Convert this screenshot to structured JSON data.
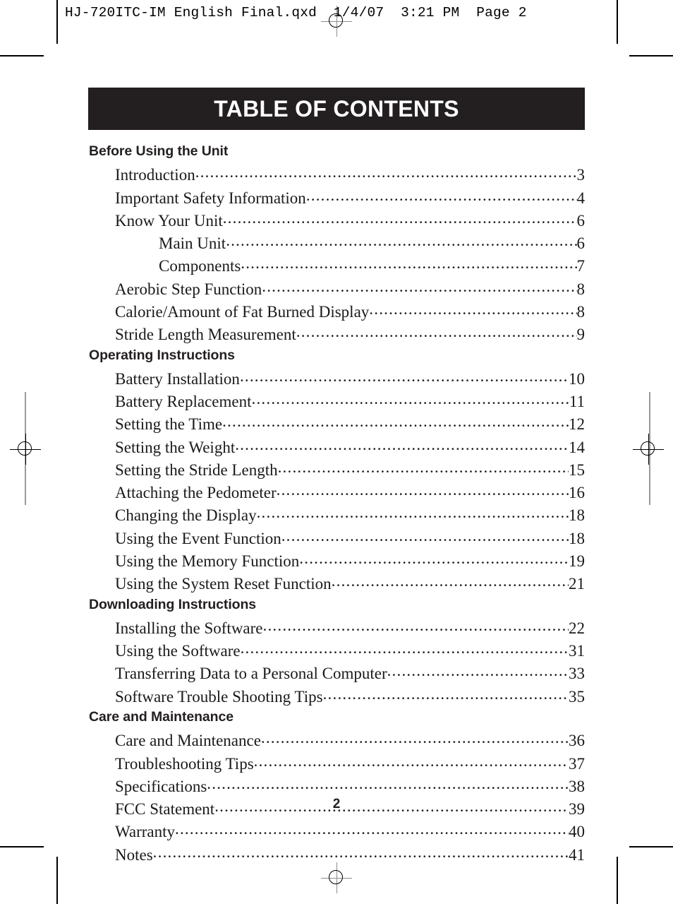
{
  "header_slug": "HJ-720ITC-IM English Final.qxd  1/4/07  3:21 PM  Page 2",
  "banner": {
    "title": "TABLE OF CONTENTS"
  },
  "folio": "2",
  "colors": {
    "banner_background": "#231f20",
    "banner_text": "#ffffff",
    "body_text": "#1a1a1a",
    "trim_line": "#9a9a9a",
    "crop_mark": "#000000"
  },
  "sections": [
    {
      "heading": "Before Using the Unit",
      "entries": [
        {
          "label": "Introduction",
          "page": "3",
          "level": 1
        },
        {
          "label": "Important Safety Information",
          "page": "4",
          "level": 1
        },
        {
          "label": "Know Your Unit",
          "page": "6",
          "level": 1
        },
        {
          "label": "Main Unit",
          "page": "6",
          "level": 2
        },
        {
          "label": "Components",
          "page": "7",
          "level": 2
        },
        {
          "label": "Aerobic Step Function",
          "page": "8",
          "level": 1
        },
        {
          "label": "Calorie/Amount of Fat Burned Display",
          "page": "8",
          "level": 1
        },
        {
          "label": "Stride Length Measurement",
          "page": "9",
          "level": 1
        }
      ]
    },
    {
      "heading": "Operating Instructions",
      "entries": [
        {
          "label": "Battery Installation",
          "page": "10",
          "level": 1
        },
        {
          "label": "Battery Replacement",
          "page": "11",
          "level": 1
        },
        {
          "label": "Setting the Time",
          "page": "12",
          "level": 1
        },
        {
          "label": "Setting the Weight",
          "page": "14",
          "level": 1
        },
        {
          "label": "Setting the Stride Length",
          "page": "15",
          "level": 1
        },
        {
          "label": "Attaching the Pedometer",
          "page": "16",
          "level": 1
        },
        {
          "label": "Changing the Display",
          "page": "18",
          "level": 1
        },
        {
          "label": "Using the Event Function",
          "page": "18",
          "level": 1
        },
        {
          "label": "Using the Memory Function",
          "page": "19",
          "level": 1
        },
        {
          "label": "Using the System Reset Function",
          "page": "21",
          "level": 1
        }
      ]
    },
    {
      "heading": "Downloading Instructions",
      "entries": [
        {
          "label": "Installing the Software",
          "page": "22",
          "level": 1
        },
        {
          "label": "Using the Software",
          "page": "31",
          "level": 1
        },
        {
          "label": "Transferring Data to a Personal Computer",
          "page": "33",
          "level": 1
        },
        {
          "label": "Software Trouble Shooting Tips",
          "page": "35",
          "level": 1
        }
      ]
    },
    {
      "heading": "Care and Maintenance",
      "entries": [
        {
          "label": "Care and Maintenance",
          "page": "36",
          "level": 1
        },
        {
          "label": "Troubleshooting Tips",
          "page": "37",
          "level": 1
        },
        {
          "label": "Specifications",
          "page": "38",
          "level": 1
        },
        {
          "label": "FCC Statement",
          "page": "39",
          "level": 1
        },
        {
          "label": "Warranty",
          "page": "40",
          "level": 1
        },
        {
          "label": "Notes",
          "page": "41",
          "level": 1
        }
      ]
    }
  ]
}
